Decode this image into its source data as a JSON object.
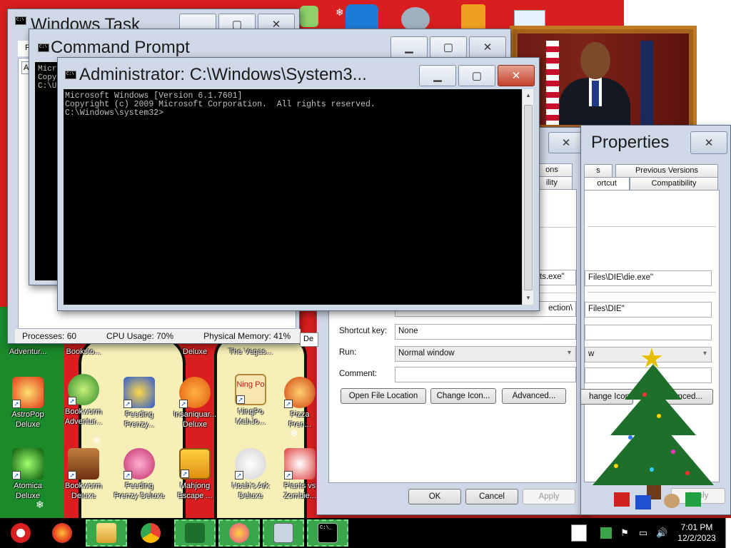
{
  "desktop": {
    "icons": [
      {
        "label_lines": [
          "Adventur..."
        ]
      },
      {
        "label_lines": [
          "Booksto..."
        ]
      },
      {
        "label_lines": [
          "Deluxe"
        ]
      },
      {
        "label_lines": [
          "The Vegas..."
        ]
      },
      {
        "label_lines": [
          "AstroPop",
          "Deluxe"
        ]
      },
      {
        "label_lines": [
          "Bookworm",
          "Adventur..."
        ]
      },
      {
        "label_lines": [
          "Feeding",
          "Frenzy..."
        ]
      },
      {
        "label_lines": [
          "Insaniquar...",
          "Deluxe"
        ]
      },
      {
        "label_lines": [
          "NingPo",
          "MahJo..."
        ]
      },
      {
        "label_lines": [
          "Pizza Fren..."
        ]
      },
      {
        "label_lines": [
          "Atomica",
          "Deluxe"
        ]
      },
      {
        "label_lines": [
          "Bookworm",
          "Deluxe"
        ]
      },
      {
        "label_lines": [
          "Feeding",
          "Frenzy Deluxe"
        ]
      },
      {
        "label_lines": [
          "Mahjong",
          "Escape ..."
        ]
      },
      {
        "label_lines": [
          "Noah's Ark",
          "Deluxe"
        ]
      },
      {
        "label_lines": [
          "Plants vs",
          "Zombie..."
        ]
      }
    ],
    "mahjong_tile_text": "Ning Po"
  },
  "task_manager": {
    "title": "Windows Task",
    "menu_first": "File",
    "tab_first": "Ap",
    "status": {
      "processes": "Processes: 60",
      "cpu": "CPU Usage: 70%",
      "memory": "Physical Memory: 41%"
    }
  },
  "command_prompt": {
    "title": "Command Prompt",
    "console_lines": [
      "Micr",
      "Copy",
      "",
      "C:\\U"
    ]
  },
  "admin_prompt": {
    "title": "Administrator: C:\\Windows\\System3...",
    "console_lines": [
      "Microsoft Windows [Version 6.1.7601]",
      "Copyright (c) 2009 Microsoft Corporation.  All rights reserved.",
      "",
      "C:\\Windows\\system32>"
    ]
  },
  "properties_back": {
    "tab_partial_top": "ons",
    "tab_partial_bottom": "ility",
    "target_value": "ts.exe\"",
    "start_in_value": "ection\\",
    "shortcut_key_label": "Shortcut key:",
    "shortcut_key_value": "None",
    "run_label": "Run:",
    "run_value": "Normal window",
    "comment_label": "Comment:",
    "comment_value": "",
    "buttons": {
      "open_location": "Open File Location",
      "change_icon": "Change Icon...",
      "advanced": "Advanced...",
      "ok": "OK",
      "cancel": "Cancel",
      "apply": "Apply"
    },
    "dialog_partial": "De"
  },
  "properties": {
    "title": "Properties",
    "tabs_top": [
      "s",
      "Previous Versions"
    ],
    "tabs_bottom": [
      "ortcut",
      "Compatibility"
    ],
    "target_value": "Files\\DIE\\die.exe\"",
    "start_in_value": "Files\\DIE\"",
    "run_value": "w",
    "change_icon_partial": "hange Icon",
    "advanced_partial": "nced...",
    "apply": "Apply"
  },
  "taskbar": {
    "time": "7:01 PM",
    "date": "12/2/2023",
    "cmd_icon_text": "C:\\_"
  },
  "colors": {
    "wallpaper_red": "#d81e1e",
    "taskbar_active": "#3aa64a",
    "console_bg": "#000000",
    "console_text": "#c0c0c0"
  }
}
